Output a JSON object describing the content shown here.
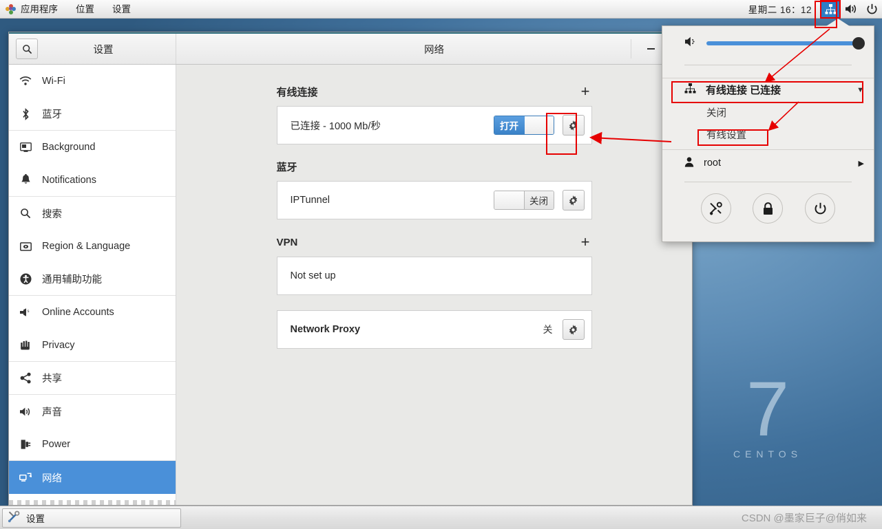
{
  "topbar": {
    "apps_label": "应用程序",
    "places_label": "位置",
    "settings_label": "设置",
    "clock": "星期二  16：12",
    "tray": {
      "network_icon": "network-wired-icon",
      "volume_icon": "volume-high-icon",
      "power_icon": "power-icon"
    }
  },
  "window": {
    "sidebar_title": "设置",
    "title": "网络",
    "search_icon": "search-icon",
    "minimize_label": "minimize",
    "maximize_label": "maximize"
  },
  "sidebar": {
    "items": [
      {
        "label": "Wi-Fi",
        "icon": "wifi-icon",
        "selected": false
      },
      {
        "label": "蓝牙",
        "icon": "bluetooth-icon",
        "selected": false
      },
      {
        "label": "Background",
        "icon": "background-icon",
        "selected": false
      },
      {
        "label": "Notifications",
        "icon": "bell-icon",
        "selected": false
      },
      {
        "label": "搜索",
        "icon": "search-icon",
        "selected": false
      },
      {
        "label": "Region & Language",
        "icon": "flag-icon",
        "selected": false
      },
      {
        "label": "通用辅助功能",
        "icon": "accessibility-icon",
        "selected": false
      },
      {
        "label": "Online Accounts",
        "icon": "online-accounts-icon",
        "selected": false
      },
      {
        "label": "Privacy",
        "icon": "hand-privacy-icon",
        "selected": false
      },
      {
        "label": "共享",
        "icon": "share-icon",
        "selected": false
      },
      {
        "label": "声音",
        "icon": "sound-icon",
        "selected": false
      },
      {
        "label": "Power",
        "icon": "power-plug-icon",
        "selected": false
      },
      {
        "label": "网络",
        "icon": "network-icon",
        "selected": true
      }
    ]
  },
  "content": {
    "sections": [
      {
        "heading": "有线连接",
        "has_plus": true,
        "plus_label": "+",
        "row": {
          "label": "已连接 - 1000 Mb/秒",
          "bold": false,
          "toggle": {
            "state": "on",
            "on_label": "打开",
            "off_label": ""
          },
          "gear_icon": "gear-icon"
        }
      },
      {
        "heading": "蓝牙",
        "has_plus": false,
        "plus_label": "",
        "row": {
          "label": "IPTunnel",
          "bold": false,
          "toggle": {
            "state": "off",
            "on_label": "",
            "off_label": "关闭"
          },
          "gear_icon": "gear-icon"
        }
      },
      {
        "heading": "VPN",
        "has_plus": true,
        "plus_label": "+",
        "row": {
          "label": "Not set up",
          "bold": false,
          "toggle": {
            "state": "none",
            "on_label": "",
            "off_label": ""
          },
          "gear_icon": ""
        }
      },
      {
        "heading": "",
        "has_plus": false,
        "plus_label": "",
        "row": {
          "label": "Network Proxy",
          "bold": true,
          "status": "关",
          "toggle": {
            "state": "none",
            "on_label": "",
            "off_label": ""
          },
          "gear_icon": "gear-icon"
        }
      }
    ]
  },
  "sysmenu": {
    "volume_icon": "volume-icon",
    "volume_value": 100,
    "network": {
      "icon": "network-wired-icon",
      "label": "有线连接  已连接",
      "chevron": "▼",
      "sub_items": [
        {
          "label": "关闭"
        },
        {
          "label": "有线设置"
        }
      ]
    },
    "user": {
      "icon": "user-icon",
      "label": "root",
      "arrow": "▶"
    },
    "actions": [
      {
        "name": "settings-tools-icon",
        "title": "settings"
      },
      {
        "name": "lock-icon",
        "title": "lock"
      },
      {
        "name": "power-icon",
        "title": "power"
      }
    ]
  },
  "desktop": {
    "logo_number": "7",
    "logo_name": "CENTOS"
  },
  "taskbar": {
    "task_label": "设置",
    "task_icon": "tools-icon",
    "watermark": "CSDN @墨家巨子@俏如来"
  },
  "colors": {
    "accent_blue": "#4a90d9",
    "highlight_red": "#e60000",
    "toggle_on": "#3a82c8"
  }
}
